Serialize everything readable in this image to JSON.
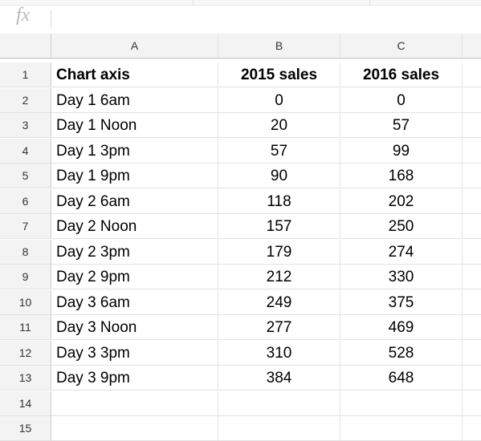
{
  "formula_bar": {
    "fx_label": "fx",
    "value": ""
  },
  "columns": [
    "A",
    "B",
    "C",
    ""
  ],
  "rows": [
    {
      "num": "1",
      "a": "Chart axis",
      "b": "2015 sales",
      "c": "2016 sales"
    },
    {
      "num": "2",
      "a": "Day 1 6am",
      "b": "0",
      "c": "0"
    },
    {
      "num": "3",
      "a": "Day 1 Noon",
      "b": "20",
      "c": "57"
    },
    {
      "num": "4",
      "a": "Day 1 3pm",
      "b": "57",
      "c": "99"
    },
    {
      "num": "5",
      "a": "Day 1 9pm",
      "b": "90",
      "c": "168"
    },
    {
      "num": "6",
      "a": "Day 2 6am",
      "b": "118",
      "c": "202"
    },
    {
      "num": "7",
      "a": "Day 2 Noon",
      "b": "157",
      "c": "250"
    },
    {
      "num": "8",
      "a": "Day 2 3pm",
      "b": "179",
      "c": "274"
    },
    {
      "num": "9",
      "a": "Day 2 9pm",
      "b": "212",
      "c": "330"
    },
    {
      "num": "10",
      "a": "Day 3 6am",
      "b": "249",
      "c": "375"
    },
    {
      "num": "11",
      "a": "Day 3 Noon",
      "b": "277",
      "c": "469"
    },
    {
      "num": "12",
      "a": "Day 3 3pm",
      "b": "310",
      "c": "528"
    },
    {
      "num": "13",
      "a": "Day 3 9pm",
      "b": "384",
      "c": "648"
    },
    {
      "num": "14",
      "a": "",
      "b": "",
      "c": ""
    },
    {
      "num": "15",
      "a": "",
      "b": "",
      "c": ""
    }
  ]
}
